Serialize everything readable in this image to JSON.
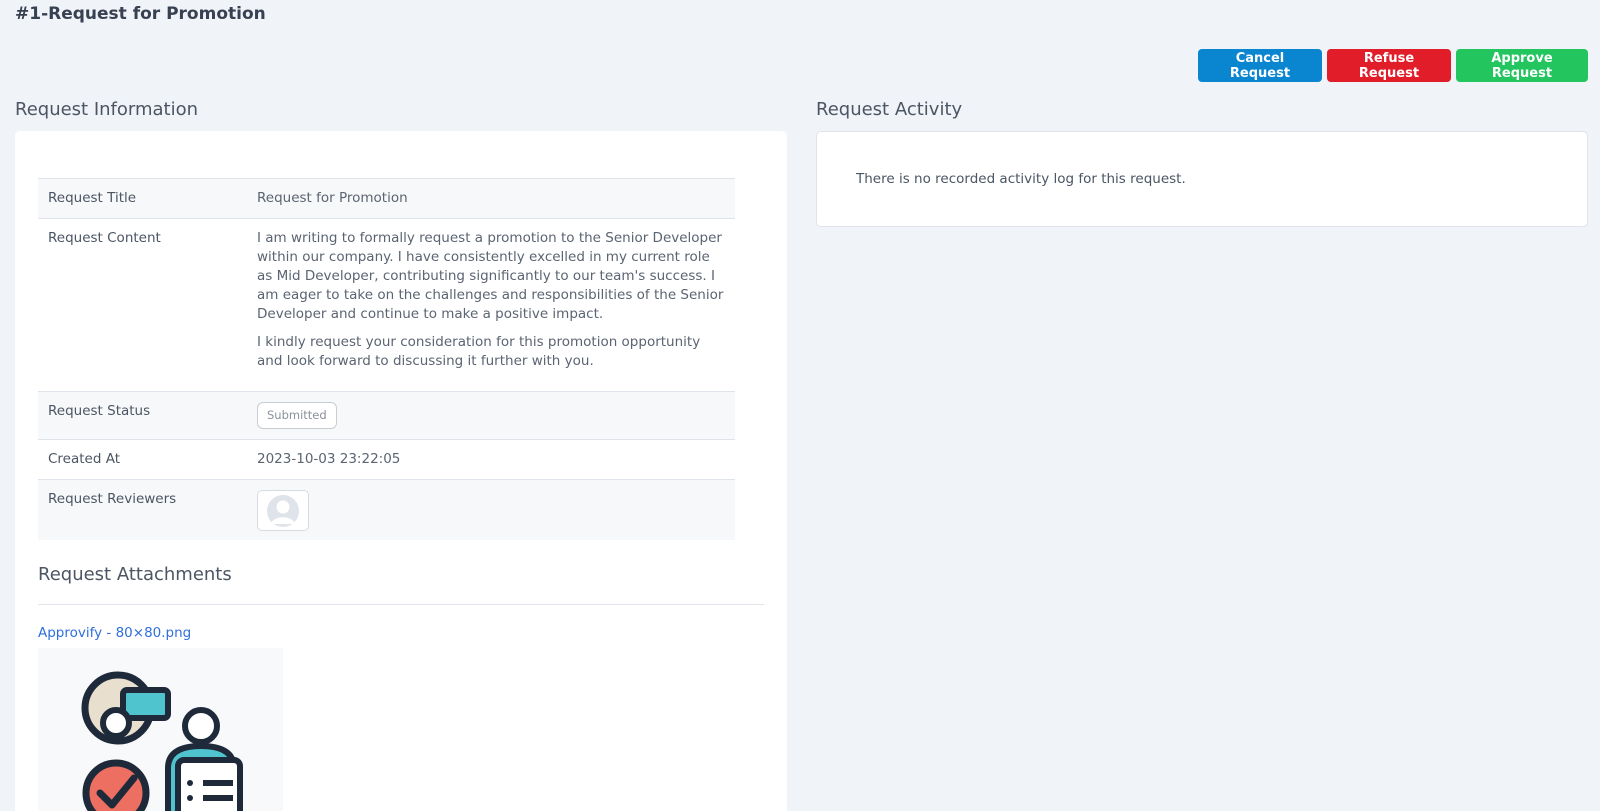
{
  "page": {
    "title": "#1-Request for Promotion"
  },
  "actions": {
    "cancel_label": "Cancel Request",
    "refuse_label": "Refuse Request",
    "approve_label": "Approve Request"
  },
  "colors": {
    "cancel": "#0a85d0",
    "refuse": "#e11d2a",
    "approve": "#22c55e",
    "link": "#2f6fdc"
  },
  "info": {
    "section_title": "Request Information",
    "rows": {
      "title": {
        "label": "Request Title",
        "value": "Request for Promotion"
      },
      "content": {
        "label": "Request Content",
        "paragraphs": [
          "I am writing to formally request a promotion to the Senior Developer within our company. I have consistently excelled in my current role as Mid Developer, contributing significantly to our team's success. I am eager to take on the challenges and responsibilities of the Senior Developer and continue to make a positive impact.",
          "I kindly request your consideration for this promotion opportunity and look forward to discussing it further with you."
        ]
      },
      "status": {
        "label": "Request Status",
        "value": "Submitted"
      },
      "created": {
        "label": "Created At",
        "value": "2023-10-03 23:22:05"
      },
      "reviewers": {
        "label": "Request Reviewers",
        "avatar_icon": "user-avatar-placeholder-icon"
      }
    }
  },
  "attachments": {
    "section_title": "Request Attachments",
    "items": [
      {
        "name": "Approvify - 80×80.png",
        "preview_icon": "approvify-logo-image"
      }
    ]
  },
  "activity": {
    "section_title": "Request Activity",
    "empty_message": "There is no recorded activity log for this request."
  }
}
